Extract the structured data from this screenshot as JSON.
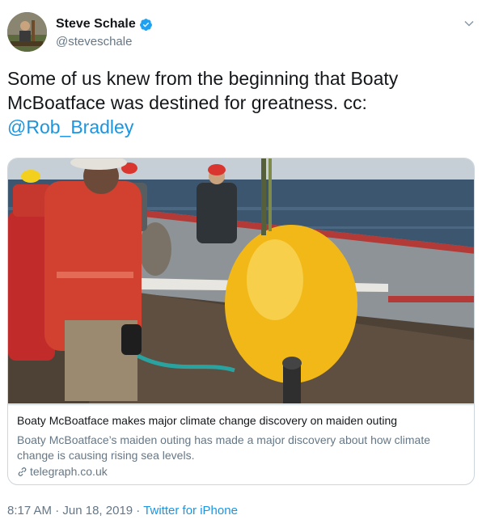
{
  "user": {
    "name": "Steve Schale",
    "handle": "@steveschale",
    "verified": true
  },
  "tweet": {
    "text": "Some of us knew from the beginning that Boaty McBoatface was destined for greatness. cc: ",
    "mention": "@Rob_Bradley"
  },
  "card": {
    "title": "Boaty McBoatface makes major climate change discovery on maiden outing",
    "description": "Boaty McBoatface’s maiden outing has made a major discovery about how climate change is causing rising sea levels.",
    "domain": "telegraph.co.uk"
  },
  "meta": {
    "time": "8:17 AM",
    "sep1": " · ",
    "date": "Jun 18, 2019",
    "sep2": " · ",
    "source": "Twitter for iPhone"
  },
  "colors": {
    "link": "#1b95e0",
    "secondary": "#657786",
    "border": "#ccd6dd",
    "submarine": "#f2b817"
  },
  "icons": [
    "verified-badge-icon",
    "chevron-down-icon",
    "link-icon"
  ]
}
